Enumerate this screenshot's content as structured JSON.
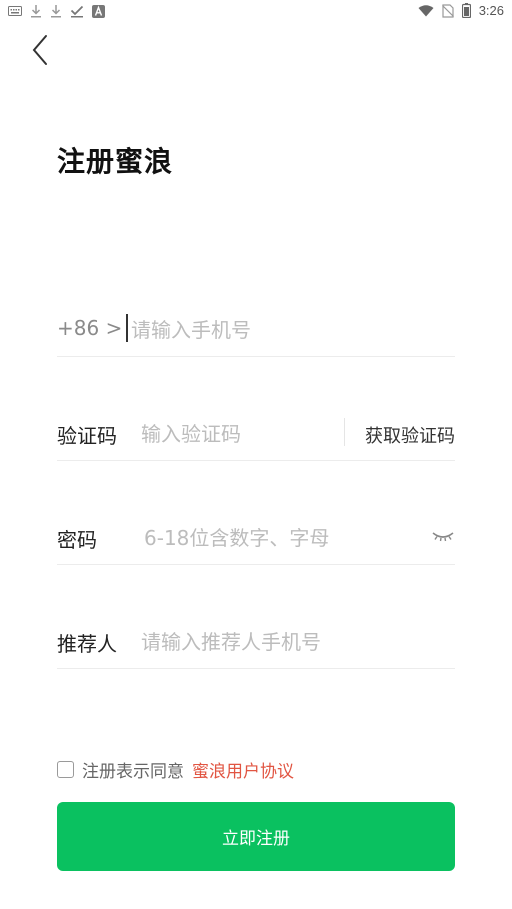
{
  "status_bar": {
    "time": "3:26",
    "left_icons": [
      "keyboard-icon",
      "download-icon",
      "download-icon",
      "check-icon",
      "a-app-icon"
    ],
    "right_icons": [
      "wifi-icon",
      "no-sim-icon",
      "battery-icon"
    ]
  },
  "page": {
    "title": "注册蜜浪"
  },
  "phone": {
    "prefix": "+86 >",
    "placeholder": "请输入手机号"
  },
  "code": {
    "label": "验证码",
    "placeholder": "输入验证码",
    "get_code_label": "获取验证码"
  },
  "password": {
    "label": "密码",
    "placeholder": "6-18位含数字、字母"
  },
  "referrer": {
    "label": "推荐人",
    "placeholder": "请输入推荐人手机号"
  },
  "agreement": {
    "text": "注册表示同意",
    "link": "蜜浪用户协议",
    "checked": false
  },
  "submit": {
    "label": "立即注册"
  },
  "colors": {
    "primary_button": "#0ac160",
    "link": "#e15542"
  }
}
